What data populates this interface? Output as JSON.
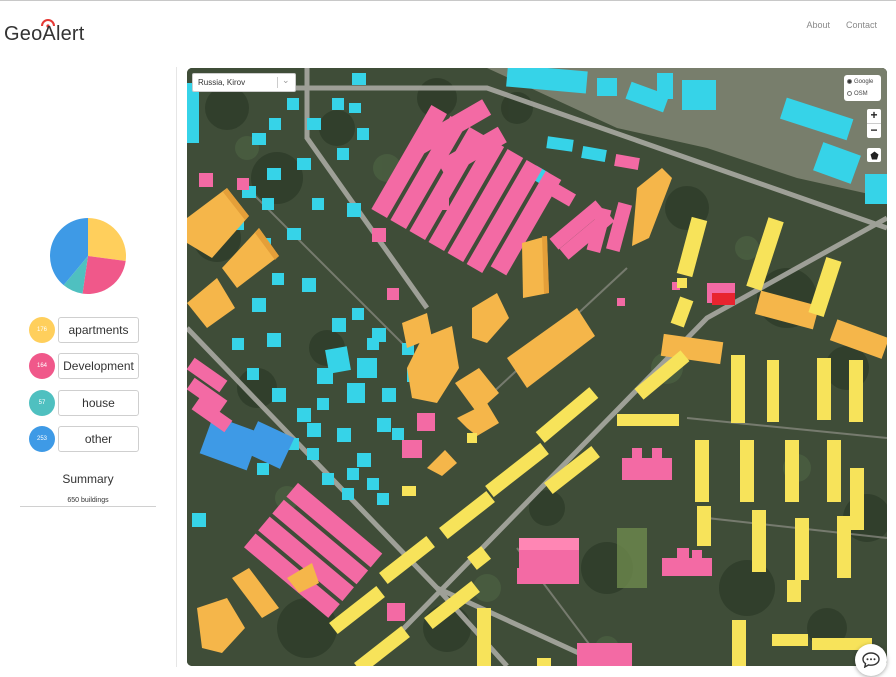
{
  "header": {
    "logo_text": "GeoAlert",
    "nav": [
      "About",
      "Contact"
    ]
  },
  "stats": {
    "categories": [
      {
        "count": "176",
        "label": "apartments",
        "color": "#ffcf5c"
      },
      {
        "count": "164",
        "label": "Development",
        "color": "#f0588a"
      },
      {
        "count": "57",
        "label": "house",
        "color": "#4fc0c0"
      },
      {
        "count": "253",
        "label": "other",
        "color": "#3e9ae6"
      }
    ],
    "summary_title": "Summary",
    "summary_count": "650   buildings"
  },
  "map": {
    "location_value": "Russia, Kirov",
    "layers": [
      "Google",
      "OSM"
    ],
    "selected_layer": "Google",
    "zoom_in": "+",
    "zoom_out": "−"
  },
  "colors": {
    "apartments": "#ffcf5c",
    "development": "#f0588a",
    "house": "#4fc0c0",
    "other_cyan": "#36d3e8",
    "yellow_blocks": "#f7e35a",
    "pink_blocks": "#f36aa4"
  }
}
